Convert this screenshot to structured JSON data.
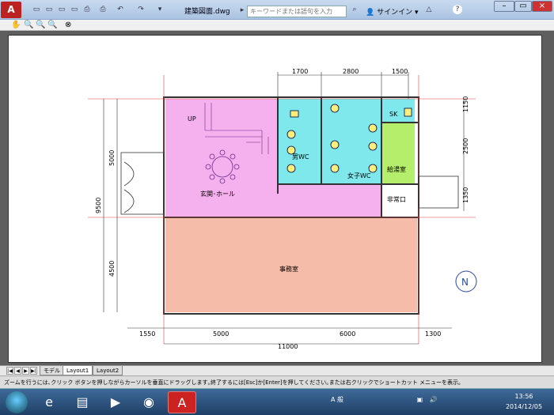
{
  "app": {
    "logo": "A",
    "doc_title": "建築図面.dwg",
    "search_placeholder": "キーワードまたは語句を入力",
    "signin": "サインイン",
    "help": "?"
  },
  "toolbar2": {
    "tools": [
      "✋",
      "🔍",
      "🔍",
      "🔍",
      "⊗"
    ]
  },
  "drawing": {
    "top_dims": [
      "1700",
      "2800",
      "1500"
    ],
    "right_dims": [
      "1150",
      "2500",
      "1350"
    ],
    "left_dims": [
      "9500",
      "5000",
      "4500"
    ],
    "bottom_dims": [
      "1550",
      "5000",
      "6000",
      "1300"
    ],
    "total_width": "11000",
    "rooms": {
      "hall": "玄関･ホール",
      "office": "事務室",
      "men_wc": "男WC",
      "women_wc": "女子WC",
      "kitchen": "給湯室",
      "sk": "SK",
      "exit": "非常口",
      "up": "UP"
    },
    "colors": {
      "hall": "#f5b0ee",
      "office": "#f4bca9",
      "wc": "#7ee8ec",
      "kitchen": "#b5ee6b",
      "wall": "#3a3a3a"
    }
  },
  "tabs": {
    "model": "モデル",
    "layout1": "Layout1",
    "layout2": "Layout2"
  },
  "command_line": "ズームを行うには､クリック ボタンを押しながらカーソルを垂直にドラッグします｡終了するには[Esc]か[Enter]を押してください｡または右クリックでショートカット メニューを表示｡",
  "taskbar": {
    "ime": "A 般",
    "clock_time": "13:56",
    "clock_date": "2014/12/05"
  }
}
